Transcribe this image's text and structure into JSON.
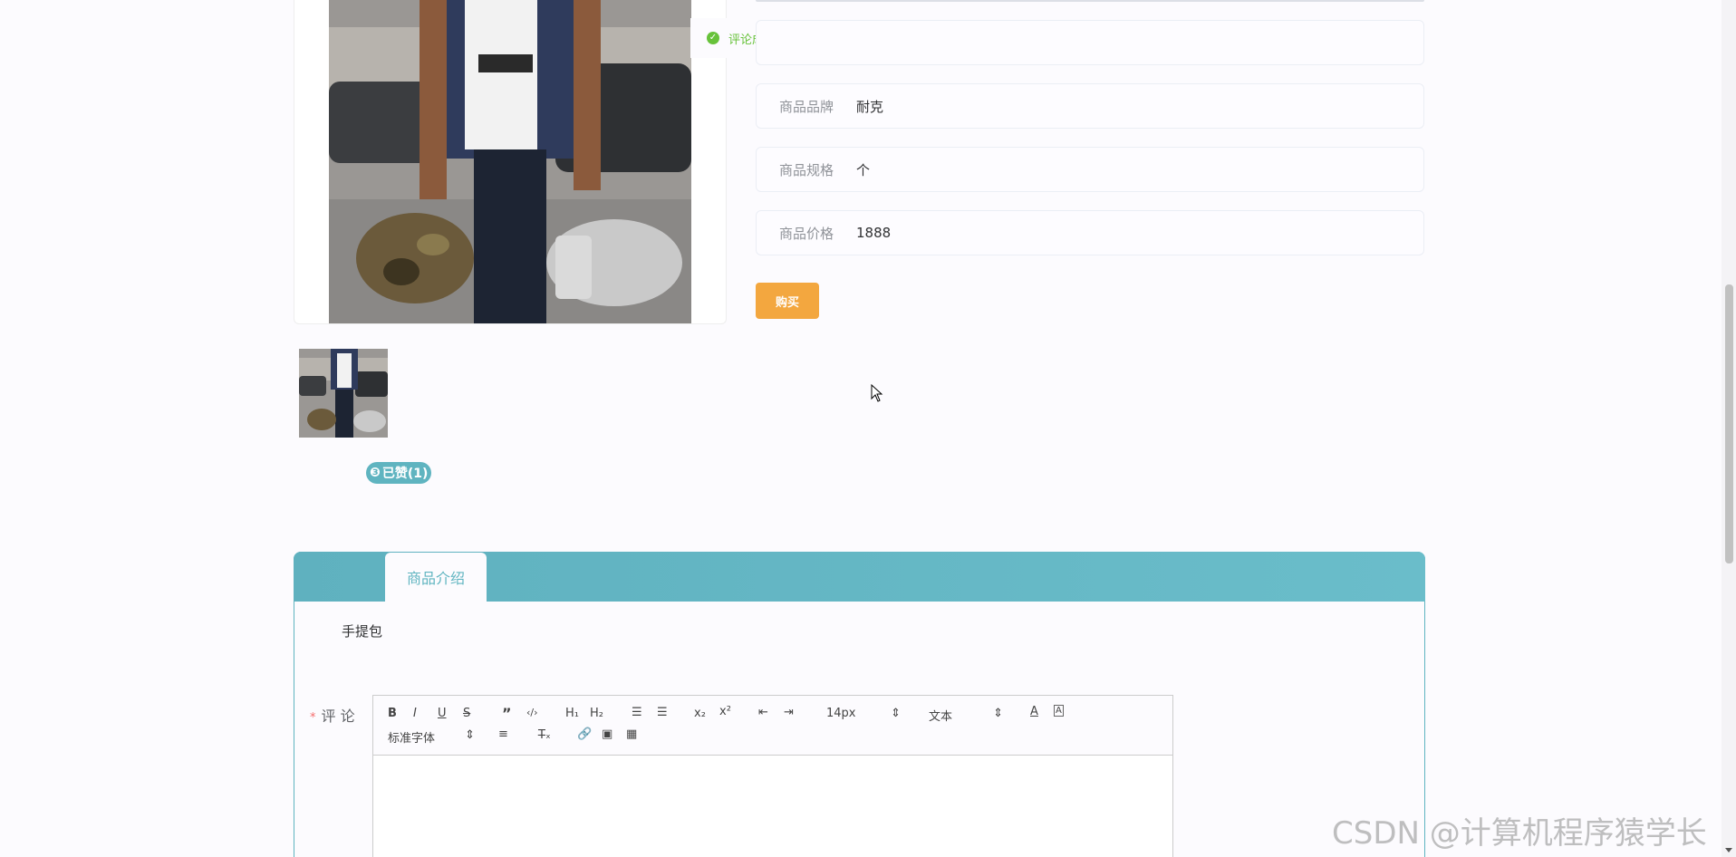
{
  "toast": {
    "icon": "check-circle-icon",
    "message": "评论成功!"
  },
  "product": {
    "info": [
      {
        "label": "",
        "value": ""
      },
      {
        "label": "商品品牌",
        "value": "耐克"
      },
      {
        "label": "商品规格",
        "value": "个"
      },
      {
        "label": "商品价格",
        "value": "1888"
      }
    ],
    "buy_label": "购买"
  },
  "like": {
    "icon": "thumbs-up-icon",
    "label": "已赞(1)"
  },
  "tabs": [
    {
      "label": "商品介绍",
      "active": true
    }
  ],
  "intro": {
    "text": "手提包"
  },
  "comment": {
    "label": "评 论",
    "required": true,
    "toolbar": {
      "row1": [
        "B",
        "I",
        "U",
        "S",
        "”",
        "</>",
        "H1",
        "H2",
        "ol",
        "ul",
        "x₂",
        "x²",
        "outdent",
        "indent"
      ],
      "font_size": "14px",
      "header_select": "文本",
      "font_family": "标准字体"
    }
  },
  "watermark": "CSDN @计算机程序猿学长",
  "colors": {
    "accent": "#5fb4c0",
    "buy": "#f3a73f",
    "success": "#67c23a"
  }
}
